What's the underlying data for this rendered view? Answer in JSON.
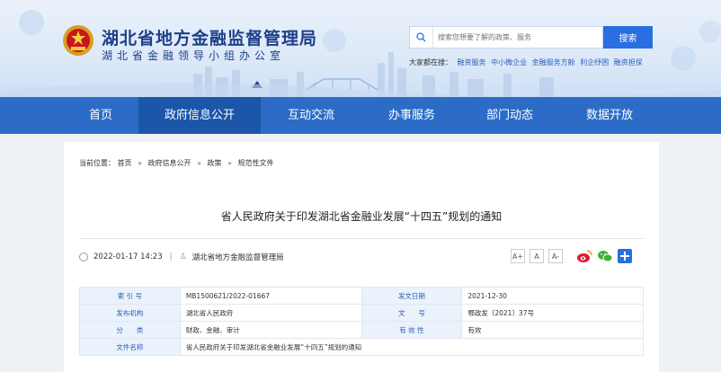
{
  "header": {
    "title": "湖北省地方金融监督管理局",
    "subtitle": "湖北省金融领导小组办公室",
    "search": {
      "placeholder": "搜索您想要了解的政策、服务",
      "button": "搜索"
    },
    "quick_links_label": "大家都在搜：",
    "quick_links": [
      "融资服务",
      "中小微企业",
      "金融服务方舱",
      "利企纾困",
      "融资担保"
    ]
  },
  "nav": {
    "items": [
      {
        "label": "首页"
      },
      {
        "label": "政府信息公开"
      },
      {
        "label": "互动交流"
      },
      {
        "label": "办事服务"
      },
      {
        "label": "部门动态"
      },
      {
        "label": "数据开放"
      }
    ],
    "active": "政府信息公开"
  },
  "breadcrumb": {
    "label": "当前位置：",
    "items": [
      "首页",
      "政府信息公开",
      "政策",
      "规范性文件"
    ],
    "separator": "»"
  },
  "article": {
    "title": "省人民政府关于印发湖北省金融业发展“十四五”规划的通知",
    "datetime": "2022-01-17 14:23",
    "divider": "|",
    "source": "湖北省地方金融监督管理局",
    "font_buttons": [
      "A+",
      "A",
      "A-"
    ]
  },
  "info_table": {
    "rows": [
      [
        {
          "label": "索 引 号",
          "value": "MB1500621/2022-01667"
        },
        {
          "label": "发文日期",
          "value": "2021-12-30"
        }
      ],
      [
        {
          "label": "发布机构",
          "value": "湖北省人民政府"
        },
        {
          "label": "文　　号",
          "value": "鄂政发〔2021〕37号"
        }
      ],
      [
        {
          "label": "分　　类",
          "value": "财政、金融、审计"
        },
        {
          "label": "有 效 性",
          "value": "有效"
        }
      ],
      [
        {
          "label": "文件名称",
          "value": "省人民政府关于印发湖北省金融业发展“十四五”规划的通知"
        }
      ]
    ]
  },
  "colors": {
    "nav": "#2c6cc7",
    "nav_active": "#1b56a9",
    "accent": "#2a6fe1",
    "title": "#1d3f8a"
  }
}
